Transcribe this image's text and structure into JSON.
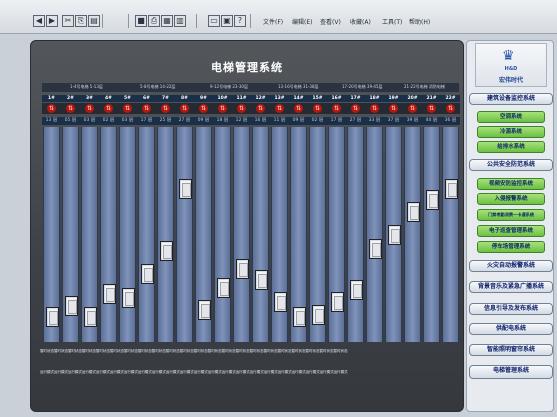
{
  "toolbar": {
    "buttons": [
      "back",
      "forward",
      "cut",
      "copy",
      "paste",
      "save",
      "print",
      "print-preview",
      "shaft",
      "grid",
      "window",
      "help"
    ],
    "menus": [
      "文件(F)",
      "编辑(E)",
      "查看(V)",
      "收藏(A)",
      "工具(T)",
      "帮助(H)"
    ]
  },
  "main": {
    "title": "电梯管理系统",
    "groups": [
      "1-4号电梯 5-13层",
      "5-8号电梯 14-22层",
      "9-12号电梯 23-30层",
      "13-16号电梯 31-38层",
      "17-20号电梯 39-45层",
      "21-22号电梯 消防电梯"
    ],
    "status_label": "暂时状态",
    "mode_label": "运行模式"
  },
  "elevators": [
    {
      "id": "1#",
      "floor": "13 层",
      "level": 0.06
    },
    {
      "id": "2#",
      "floor": "05 层",
      "level": 0.12
    },
    {
      "id": "3#",
      "floor": "03 层",
      "level": 0.06
    },
    {
      "id": "4#",
      "floor": "02 层",
      "level": 0.18
    },
    {
      "id": "5#",
      "floor": "03 层",
      "level": 0.16
    },
    {
      "id": "6#",
      "floor": "17 层",
      "level": 0.28
    },
    {
      "id": "7#",
      "floor": "25 层",
      "level": 0.4
    },
    {
      "id": "8#",
      "floor": "27 层",
      "level": 0.72
    },
    {
      "id": "9#",
      "floor": "09 层",
      "level": 0.1
    },
    {
      "id": "10#",
      "floor": "18 层",
      "level": 0.21
    },
    {
      "id": "11#",
      "floor": "12 层",
      "level": 0.31
    },
    {
      "id": "12#",
      "floor": "16 层",
      "level": 0.25
    },
    {
      "id": "13#",
      "floor": "11 层",
      "level": 0.14
    },
    {
      "id": "14#",
      "floor": "09 层",
      "level": 0.06
    },
    {
      "id": "15#",
      "floor": "02 层",
      "level": 0.07
    },
    {
      "id": "16#",
      "floor": "17 层",
      "level": 0.14
    },
    {
      "id": "17#",
      "floor": "27 层",
      "level": 0.2
    },
    {
      "id": "18#",
      "floor": "33 层",
      "level": 0.41
    },
    {
      "id": "19#",
      "floor": "37 层",
      "level": 0.48
    },
    {
      "id": "20#",
      "floor": "39 层",
      "level": 0.6
    },
    {
      "id": "21#",
      "floor": "44 层",
      "level": 0.66
    },
    {
      "id": "22#",
      "floor": "36 层",
      "level": 0.72
    }
  ],
  "sidebar": {
    "logo_en": "H&D",
    "logo_cn": "宏伟时代",
    "nav": [
      {
        "type": "cat",
        "label": "建筑设备监控系统"
      },
      {
        "type": "sub",
        "label": "空调系统"
      },
      {
        "type": "sub",
        "label": "冷源系统"
      },
      {
        "type": "sub",
        "label": "给排水系统"
      },
      {
        "type": "cat",
        "label": "公共安全防范系统"
      },
      {
        "type": "sub",
        "label": "视频安防监控系统"
      },
      {
        "type": "sub",
        "label": "入侵报警系统"
      },
      {
        "type": "sub",
        "label": "门禁考勤消费一卡通系统",
        "small": true
      },
      {
        "type": "sub",
        "label": "电子巡查管理系统"
      },
      {
        "type": "sub",
        "label": "停车场管理系统"
      },
      {
        "type": "cat",
        "label": "火灾自动报警系统"
      },
      {
        "type": "cat",
        "label": "背景音乐及紧急广播系统",
        "small": true
      },
      {
        "type": "cat",
        "label": "信息引导及发布系统"
      },
      {
        "type": "cat",
        "label": "供配电系统"
      },
      {
        "type": "cat",
        "label": "智能照明窗帘系统"
      },
      {
        "type": "cat",
        "label": "电梯管理系统"
      }
    ]
  }
}
